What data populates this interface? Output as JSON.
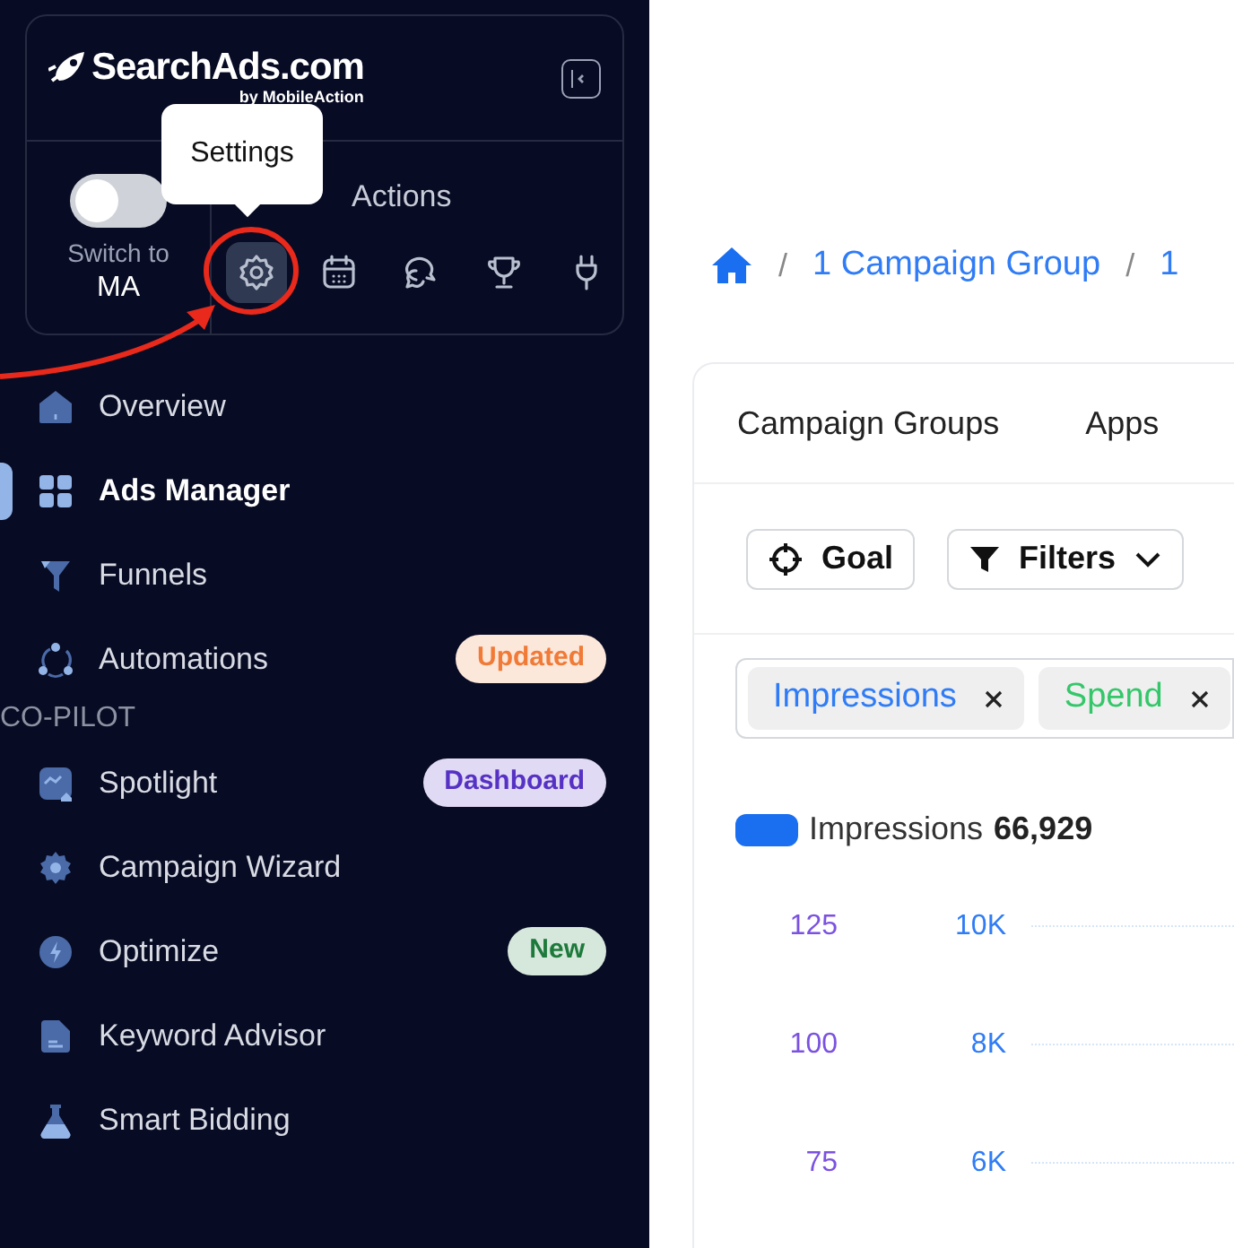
{
  "logo": {
    "name": "SearchAds.com",
    "byline": "by MobileAction"
  },
  "switch": {
    "label": "Switch to",
    "target": "MA",
    "on": false
  },
  "quick_actions": {
    "title": "Actions",
    "tooltip": "Settings",
    "items": [
      {
        "kind": "settings",
        "selected": true
      },
      {
        "kind": "calendar",
        "selected": false
      },
      {
        "kind": "chat",
        "selected": false
      },
      {
        "kind": "trophy",
        "selected": false
      },
      {
        "kind": "plug",
        "selected": false
      }
    ]
  },
  "nav_sections": [
    {
      "items": [
        {
          "label": "Overview",
          "kind": "home",
          "selected": false
        },
        {
          "label": "Ads Manager",
          "kind": "grid",
          "selected": true
        },
        {
          "label": "Funnels",
          "kind": "funnel",
          "selected": false
        },
        {
          "label": "Automations",
          "kind": "cycle",
          "selected": false,
          "badge": {
            "text": "Updated",
            "color": "#f07a36"
          }
        }
      ]
    },
    {
      "title": "CO-PILOT",
      "items": [
        {
          "label": "Spotlight",
          "kind": "spotlight",
          "selected": false,
          "badge": {
            "text": "Dashboard",
            "color": "#5632c4"
          }
        },
        {
          "label": "Campaign Wizard",
          "kind": "cog",
          "selected": false
        },
        {
          "label": "Optimize",
          "kind": "bolt",
          "selected": false,
          "badge": {
            "text": "New",
            "color": "#1d7a3b"
          }
        },
        {
          "label": "Keyword Advisor",
          "kind": "doc",
          "selected": false
        },
        {
          "label": "Smart Bidding",
          "kind": "flask",
          "selected": false
        }
      ]
    }
  ],
  "breadcrumb": [
    {
      "kind": "separator",
      "text": "/"
    },
    {
      "kind": "link",
      "text": "1 Campaign Group"
    },
    {
      "kind": "separator",
      "text": "/"
    },
    {
      "kind": "link",
      "text": "1"
    }
  ],
  "tabs": [
    "Campaign Groups",
    "Apps"
  ],
  "toolbar": [
    {
      "label": "Goal",
      "kind": "goal"
    },
    {
      "label": "Filters",
      "kind": "filters"
    }
  ],
  "metric_chips": [
    {
      "label": "Impressions",
      "color": "#2f7cf6"
    },
    {
      "label": "Spend",
      "color": "#34c76a"
    }
  ],
  "legend": {
    "label": "Impressions",
    "value": "66,929",
    "color": "#1a6ef0"
  },
  "axis_left_ticks": [
    "125",
    "100",
    "75"
  ],
  "axis_right_ticks": [
    "10K",
    "8K",
    "6K"
  ]
}
